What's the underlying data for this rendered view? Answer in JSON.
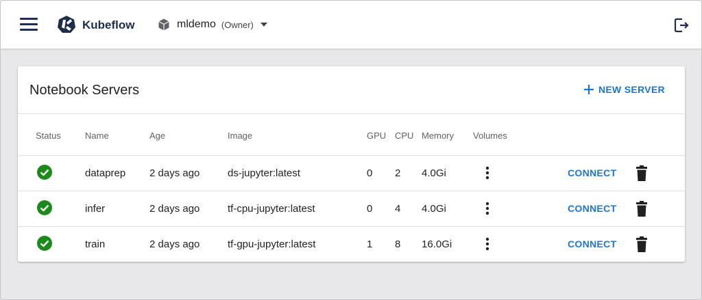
{
  "header": {
    "brand": "Kubeflow",
    "namespace": "mldemo",
    "role": "(Owner)"
  },
  "card": {
    "title": "Notebook Servers",
    "new_server_label": "NEW SERVER"
  },
  "table": {
    "columns": [
      "Status",
      "Name",
      "Age",
      "Image",
      "GPU",
      "CPU",
      "Memory",
      "Volumes"
    ],
    "connect_label": "CONNECT",
    "rows": [
      {
        "status": "ready",
        "name": "dataprep",
        "age": "2 days ago",
        "image": "ds-jupyter:latest",
        "gpu": "0",
        "cpu": "2",
        "memory": "4.0Gi"
      },
      {
        "status": "ready",
        "name": "infer",
        "age": "2 days ago",
        "image": "tf-cpu-jupyter:latest",
        "gpu": "0",
        "cpu": "4",
        "memory": "4.0Gi"
      },
      {
        "status": "ready",
        "name": "train",
        "age": "2 days ago",
        "image": "tf-gpu-jupyter:latest",
        "gpu": "1",
        "cpu": "8",
        "memory": "16.0Gi"
      }
    ]
  },
  "icons": {
    "menu": "hamburger-menu-icon",
    "logo": "kubeflow-logo-icon",
    "namespace": "cube-icon",
    "logout": "logout-icon",
    "add": "plus-icon",
    "status": "check-circle-icon",
    "volumes": "more-vertical-icon",
    "delete": "trash-icon"
  },
  "colors": {
    "accent": "#1976d2",
    "brand": "#1e2d4a",
    "status_ok": "#1b8a1b",
    "background": "#e8e8ea"
  }
}
